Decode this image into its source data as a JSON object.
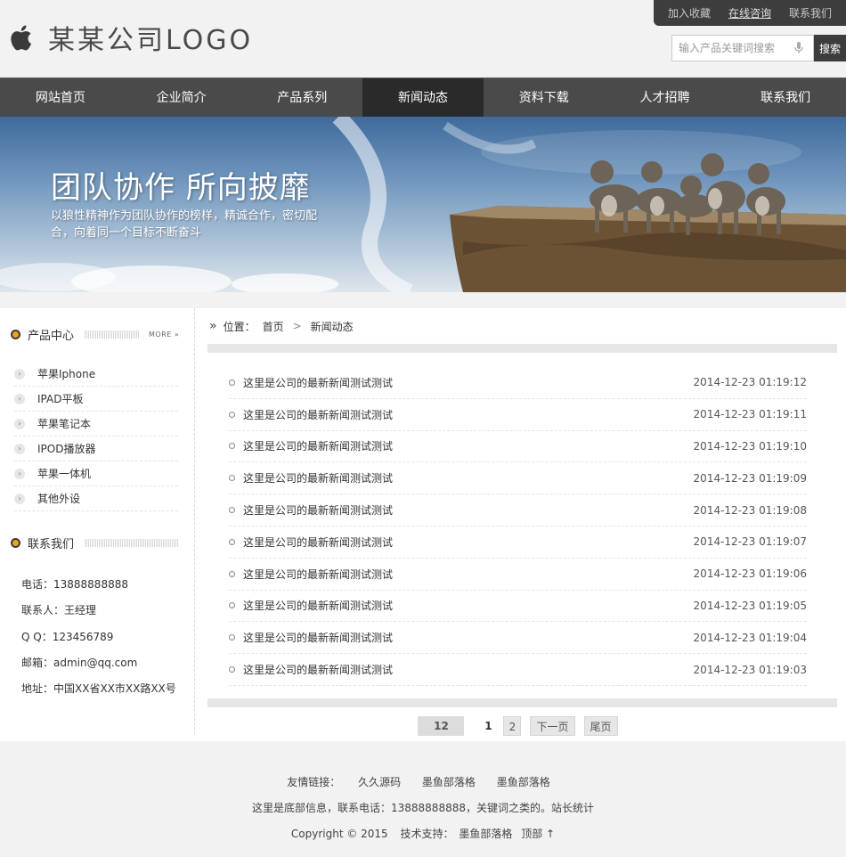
{
  "header": {
    "logo_text": "某某公司LOGO",
    "top_links": [
      "加入收藏",
      "在线咨询",
      "联系我们"
    ],
    "search_placeholder": "输入产品关键词搜索",
    "search_button": "搜索"
  },
  "nav": {
    "items": [
      "网站首页",
      "企业简介",
      "产品系列",
      "新闻动态",
      "资料下载",
      "人才招聘",
      "联系我们"
    ],
    "active": "新闻动态"
  },
  "banner": {
    "title": "团队协作 所向披靡",
    "subtitle": "以狼性精神作为团队协作的榜样，精诚合作，密切配合，向着同一个目标不断奋斗"
  },
  "sidebar": {
    "product_title": "产品中心",
    "more": "MORE »",
    "categories": [
      "苹果Iphone",
      "IPAD平板",
      "苹果笔记本",
      "IPOD播放器",
      "苹果一体机",
      "其他外设"
    ],
    "contact_title": "联系我们",
    "contact": [
      "电话：13888888888",
      "联系人：王经理",
      "Q Q：123456789",
      "邮箱：admin@qq.com",
      "地址：中国XX省XX市XX路XX号"
    ]
  },
  "content": {
    "crumb_prefix": "位置：",
    "crumb_home": "首页",
    "crumb_sep": ">",
    "crumb_current": "新闻动态",
    "news": [
      {
        "title": "这里是公司的最新新闻测试测试",
        "date": "2014-12-23 01:19:12"
      },
      {
        "title": "这里是公司的最新新闻测试测试",
        "date": "2014-12-23 01:19:11"
      },
      {
        "title": "这里是公司的最新新闻测试测试",
        "date": "2014-12-23 01:19:10"
      },
      {
        "title": "这里是公司的最新新闻测试测试",
        "date": "2014-12-23 01:19:09"
      },
      {
        "title": "这里是公司的最新新闻测试测试",
        "date": "2014-12-23 01:19:08"
      },
      {
        "title": "这里是公司的最新新闻测试测试",
        "date": "2014-12-23 01:19:07"
      },
      {
        "title": "这里是公司的最新新闻测试测试",
        "date": "2014-12-23 01:19:06"
      },
      {
        "title": "这里是公司的最新新闻测试测试",
        "date": "2014-12-23 01:19:05"
      },
      {
        "title": "这里是公司的最新新闻测试测试",
        "date": "2014-12-23 01:19:04"
      },
      {
        "title": "这里是公司的最新新闻测试测试",
        "date": "2014-12-23 01:19:03"
      }
    ],
    "pager": {
      "total": "12",
      "current": "1",
      "page2": "2",
      "next": "下一页",
      "last": "尾页"
    }
  },
  "footer": {
    "links_label": "友情链接：",
    "links": [
      "久久源码",
      "墨鱼部落格",
      "墨鱼部落格"
    ],
    "info": "这里是底部信息，联系电话：13888888888，关键词之类的。站长统计",
    "copyright": "Copyright © 2015",
    "support_label": "技术支持：",
    "support": "墨鱼部落格",
    "top": "顶部 ↑"
  }
}
